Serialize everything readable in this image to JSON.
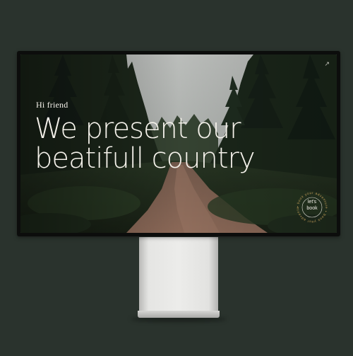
{
  "hero": {
    "greeting": "Hi friend",
    "headline_line1": "We present our",
    "headline_line2": "beatifull country"
  },
  "cta": {
    "label_line1": "let's",
    "label_line2": "book",
    "ring_text": "• book your adventure • book your adventure "
  },
  "icons": {
    "top_right": "expand-icon"
  },
  "colors": {
    "background": "#2a332d",
    "text": "#f4f1ea",
    "badge_ring": "#c9a15a",
    "road": "#8a6a55"
  }
}
